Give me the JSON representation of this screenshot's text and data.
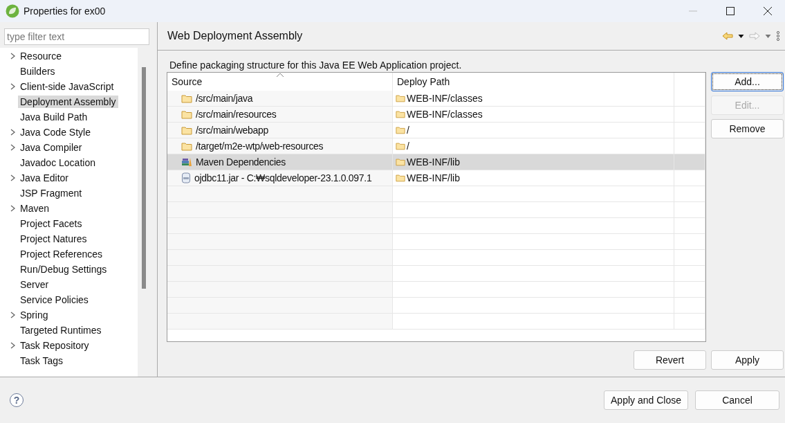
{
  "window": {
    "title": "Properties for ex00"
  },
  "filter": {
    "placeholder": "type filter text"
  },
  "tree": [
    {
      "label": "Resource",
      "has_children": true,
      "selected": false
    },
    {
      "label": "Builders",
      "has_children": false,
      "selected": false
    },
    {
      "label": "Client-side JavaScript",
      "has_children": true,
      "selected": false
    },
    {
      "label": "Deployment Assembly",
      "has_children": false,
      "selected": true
    },
    {
      "label": "Java Build Path",
      "has_children": false,
      "selected": false
    },
    {
      "label": "Java Code Style",
      "has_children": true,
      "selected": false
    },
    {
      "label": "Java Compiler",
      "has_children": true,
      "selected": false
    },
    {
      "label": "Javadoc Location",
      "has_children": false,
      "selected": false
    },
    {
      "label": "Java Editor",
      "has_children": true,
      "selected": false
    },
    {
      "label": "JSP Fragment",
      "has_children": false,
      "selected": false
    },
    {
      "label": "Maven",
      "has_children": true,
      "selected": false
    },
    {
      "label": "Project Facets",
      "has_children": false,
      "selected": false
    },
    {
      "label": "Project Natures",
      "has_children": false,
      "selected": false
    },
    {
      "label": "Project References",
      "has_children": false,
      "selected": false
    },
    {
      "label": "Run/Debug Settings",
      "has_children": false,
      "selected": false
    },
    {
      "label": "Server",
      "has_children": false,
      "selected": false
    },
    {
      "label": "Service Policies",
      "has_children": false,
      "selected": false
    },
    {
      "label": "Spring",
      "has_children": true,
      "selected": false
    },
    {
      "label": "Targeted Runtimes",
      "has_children": false,
      "selected": false
    },
    {
      "label": "Task Repository",
      "has_children": true,
      "selected": false
    },
    {
      "label": "Task Tags",
      "has_children": false,
      "selected": false
    }
  ],
  "page": {
    "title": "Web Deployment Assembly",
    "description": "Define packaging structure for this Java EE Web Application project."
  },
  "table": {
    "columns": [
      "Source",
      "Deploy Path"
    ],
    "rows": [
      {
        "source": "/src/main/java",
        "kind": "folder",
        "deploy_path": "WEB-INF/classes",
        "selected": false
      },
      {
        "source": "/src/main/resources",
        "kind": "folder",
        "deploy_path": "WEB-INF/classes",
        "selected": false
      },
      {
        "source": "/src/main/webapp",
        "kind": "folder",
        "deploy_path": "/",
        "selected": false
      },
      {
        "source": "/target/m2e-wtp/web-resources",
        "kind": "folder",
        "deploy_path": "/",
        "selected": false
      },
      {
        "source": "Maven Dependencies",
        "kind": "library",
        "deploy_path": "WEB-INF/lib",
        "selected": true
      },
      {
        "source": "ojdbc11.jar - C:₩sqldeveloper-23.1.0.097.1",
        "kind": "jar",
        "deploy_path": "WEB-INF/lib",
        "selected": false
      }
    ]
  },
  "side_buttons": [
    {
      "label": "Add...",
      "disabled": false,
      "focused": true
    },
    {
      "label": "Edit...",
      "disabled": true,
      "focused": false
    },
    {
      "label": "Remove",
      "disabled": false,
      "focused": false
    }
  ],
  "page_buttons": [
    "Revert",
    "Apply"
  ],
  "help_button": "?",
  "dialog_buttons": [
    "Apply and Close",
    "Cancel"
  ]
}
